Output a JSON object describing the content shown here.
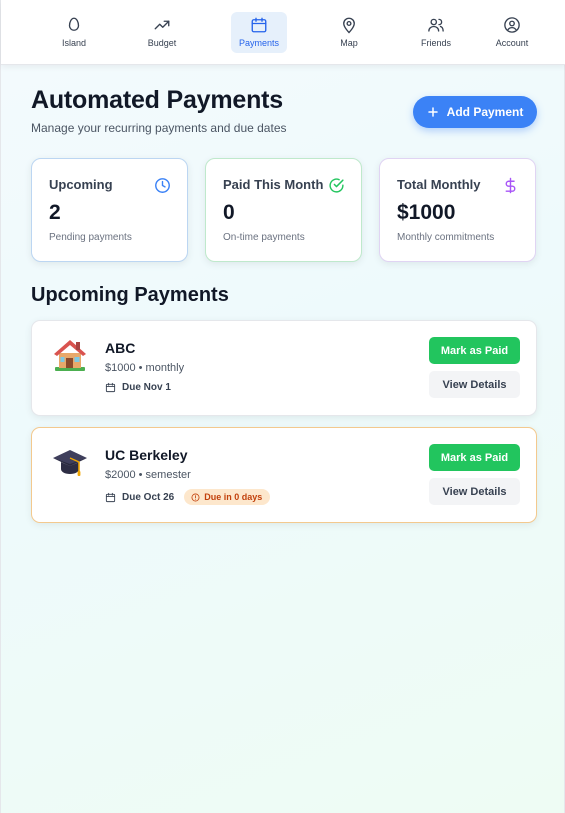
{
  "nav": {
    "items": [
      {
        "label": "Island",
        "icon": "egg-icon",
        "active": false
      },
      {
        "label": "Budget",
        "icon": "trending-up-icon",
        "active": false
      },
      {
        "label": "Payments",
        "icon": "calendar-icon",
        "active": true
      },
      {
        "label": "Map",
        "icon": "map-pin-icon",
        "active": false
      },
      {
        "label": "Friends",
        "icon": "users-icon",
        "active": false
      },
      {
        "label": "Account",
        "icon": "user-circle-icon",
        "active": false
      }
    ],
    "active_color": "#2563eb"
  },
  "header": {
    "title": "Automated Payments",
    "subtitle": "Manage your recurring payments and due dates",
    "add_button_label": "Add Payment",
    "add_button_icon": "plus-icon",
    "accent": "#3b82f6"
  },
  "stats": [
    {
      "label": "Upcoming",
      "value": "2",
      "note": "Pending payments",
      "icon": "clock-icon",
      "color": "#3b82f6"
    },
    {
      "label": "Paid This Month",
      "value": "0",
      "note": "On-time payments",
      "icon": "check-circle-icon",
      "color": "#22c55e"
    },
    {
      "label": "Total Monthly",
      "value": "$1000",
      "note": "Monthly commitments",
      "icon": "dollar-icon",
      "color": "#a855f7"
    }
  ],
  "section": {
    "title": "Upcoming Payments"
  },
  "payments": [
    {
      "name": "ABC",
      "amount": "$1000",
      "frequency": "monthly",
      "amount_line": "$1000 • monthly",
      "due": "Due Nov 1",
      "badge": "",
      "icon": "house-icon",
      "mark_label": "Mark as Paid",
      "view_label": "View Details"
    },
    {
      "name": "UC Berkeley",
      "amount": "$2000",
      "frequency": "semester",
      "amount_line": "$2000 • semester",
      "due": "Due Oct 26",
      "badge": "Due in 0 days",
      "icon": "graduation-cap-icon",
      "mark_label": "Mark as Paid",
      "view_label": "View Details"
    }
  ],
  "colors": {
    "success": "#22c55e",
    "warning_bg": "#fde7cc",
    "warning_text": "#c2410c"
  }
}
